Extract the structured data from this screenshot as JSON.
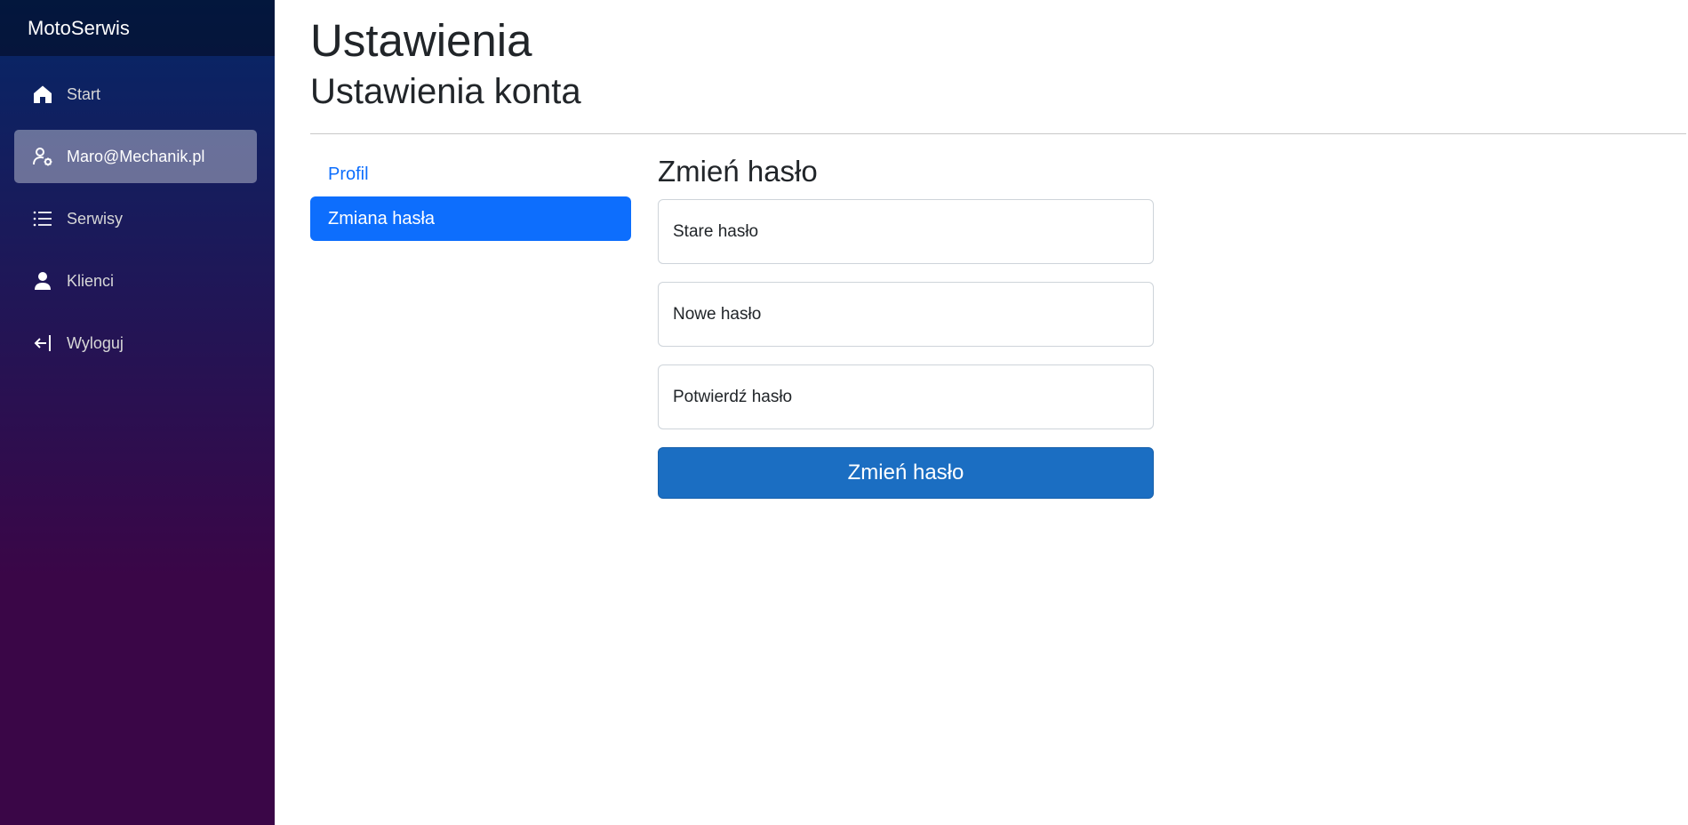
{
  "sidebar": {
    "brand": "MotoSerwis",
    "items": [
      {
        "label": "Start",
        "icon": "home-icon"
      },
      {
        "label": "Maro@Mechanik.pl",
        "icon": "user-gear-icon",
        "active": true
      },
      {
        "label": "Serwisy",
        "icon": "list-icon"
      },
      {
        "label": "Klienci",
        "icon": "person-icon"
      },
      {
        "label": "Wyloguj",
        "icon": "logout-icon"
      }
    ]
  },
  "header": {
    "title": "Ustawienia",
    "subtitle": "Ustawienia konta"
  },
  "settings_nav": {
    "items": [
      {
        "label": "Profil"
      },
      {
        "label": "Zmiana hasła",
        "active": true
      }
    ]
  },
  "form": {
    "heading": "Zmień hasło",
    "fields": [
      {
        "label": "Stare hasło"
      },
      {
        "label": "Nowe hasło"
      },
      {
        "label": "Potwierdź hasło"
      }
    ],
    "submit_label": "Zmień hasło"
  },
  "colors": {
    "sidebar_top": "#052767",
    "sidebar_bottom": "#3a0647",
    "link": "#0d6efd",
    "button": "#1b6ec2"
  }
}
